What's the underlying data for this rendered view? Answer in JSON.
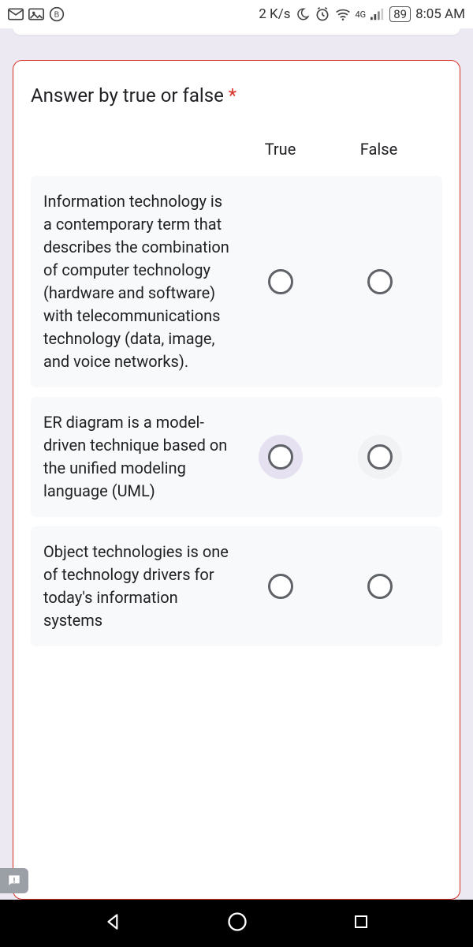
{
  "status": {
    "net_speed": "2 K/s",
    "net_label": "4G",
    "battery": "89",
    "clock": "8:05 AM"
  },
  "question": {
    "title": "Answer by true or false",
    "required_mark": "*",
    "columns": {
      "true": "True",
      "false": "False"
    },
    "rows": [
      {
        "text": "Information technology is a contemporary term that describes the combination of computer technology (hardware and software) with telecommunications technology (data, image, and voice networks)."
      },
      {
        "text": "ER diagram is a model-driven technique based on the unified modeling language (UML)"
      },
      {
        "text": "Object technologies is one of technology drivers for today's information systems"
      }
    ]
  }
}
